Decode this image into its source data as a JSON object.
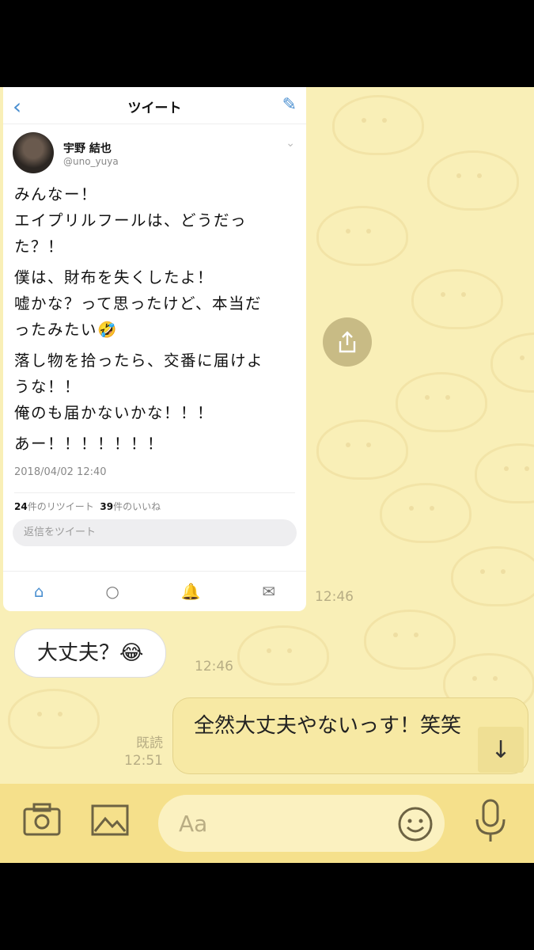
{
  "tweet": {
    "header_title": "ツイート",
    "user_name": "宇野 結也",
    "user_handle": "@uno_yuya",
    "paragraphs": [
      [
        "みんなー！",
        "エイプリルフールは、どうだっ",
        "た？！"
      ],
      [
        "僕は、財布を失くしたよ！",
        "嘘かな？って思ったけど、本当だ",
        "ったみたい🤣"
      ],
      [
        "落し物を拾ったら、交番に届けよ",
        "うな！！",
        "俺のも届かないかな！！！"
      ],
      [
        "あー！！！！！！！"
      ]
    ],
    "date": "2018/04/02 12:40",
    "retweet_count": "24",
    "retweet_label": "件のリツイート",
    "like_count": "39",
    "like_label": "件のいいね",
    "reply_placeholder": "返信をツイート",
    "nav_icons": [
      "home-icon",
      "search-icon",
      "notification-icon",
      "mail-icon"
    ]
  },
  "messages": {
    "image_time": "12:46",
    "incoming_text": "大丈夫？😂",
    "incoming_time": "12:46",
    "outgoing_text": "全然大丈夫やないっす！笑笑",
    "read_label": "既読",
    "outgoing_time": "12:51"
  },
  "input_bar": {
    "placeholder": "Aa",
    "icons": [
      "camera-icon",
      "image-icon",
      "emoji-icon",
      "microphone-icon"
    ]
  },
  "colors": {
    "chat_background": "#f9efb7",
    "outgoing_bubble": "#f7e9a4",
    "input_bar": "#f5e08b",
    "twitter_blue": "#4a8fd0"
  }
}
